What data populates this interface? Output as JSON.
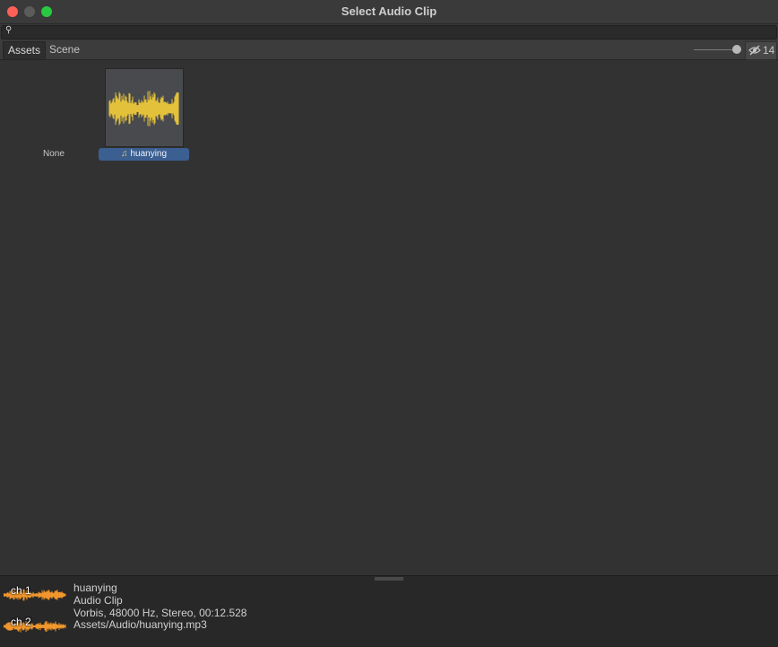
{
  "window": {
    "title": "Select Audio Clip"
  },
  "search": {
    "value": "",
    "placeholder": ""
  },
  "tabs": [
    {
      "label": "Assets",
      "active": true
    },
    {
      "label": "Scene",
      "active": false
    }
  ],
  "toolbar": {
    "hidden_count": "14",
    "icon": "eye-slash-icon"
  },
  "assets": {
    "none_label": "None",
    "items": [
      {
        "name": "huanying",
        "icon": "music-note-icon",
        "selected": true
      }
    ]
  },
  "preview": {
    "channels": [
      "ch 1",
      "ch 2"
    ],
    "name": "huanying",
    "type": "Audio Clip",
    "details": "Vorbis, 48000 Hz, Stereo, 00:12.528",
    "path": "Assets/Audio/huanying.mp3"
  },
  "colors": {
    "selection": "#3b5f91",
    "waveform_thumb": "#e3c13a",
    "waveform_preview": "#f0962c"
  }
}
